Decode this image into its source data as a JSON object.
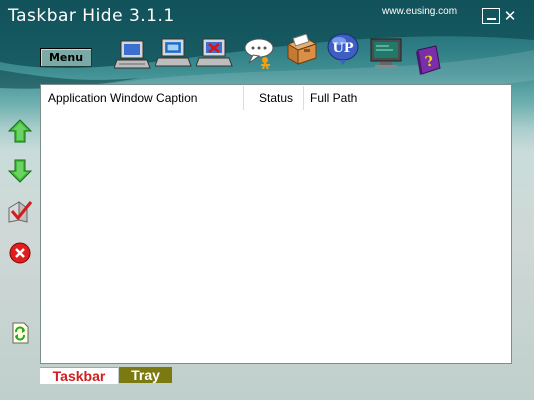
{
  "window": {
    "title": "Taskbar Hide 3.1.1",
    "website": "www.eusing.com",
    "minimize_glyph": "_",
    "close_glyph": "✕"
  },
  "toolbar": {
    "menu_label": "Menu",
    "icons": [
      "show-window-icon",
      "hide-window-icon",
      "close-window-icon",
      "chat-icon",
      "file-cabinet-icon",
      "update-icon",
      "screen-icon",
      "help-book-icon"
    ]
  },
  "sidebar": {
    "icons": [
      "arrow-up-icon",
      "arrow-down-icon",
      "checkmark-icon",
      "delete-icon",
      "refresh-icon"
    ]
  },
  "list": {
    "columns": [
      "Application  Window Caption",
      "Status",
      "Full Path"
    ],
    "rows": []
  },
  "tabs": {
    "taskbar": "Taskbar",
    "tray": "Tray",
    "active": "Taskbar"
  },
  "colors": {
    "tab_taskbar_text": "#d11d1d",
    "tab_tray_bg": "#7a7a10",
    "accent": "#1d6169"
  }
}
